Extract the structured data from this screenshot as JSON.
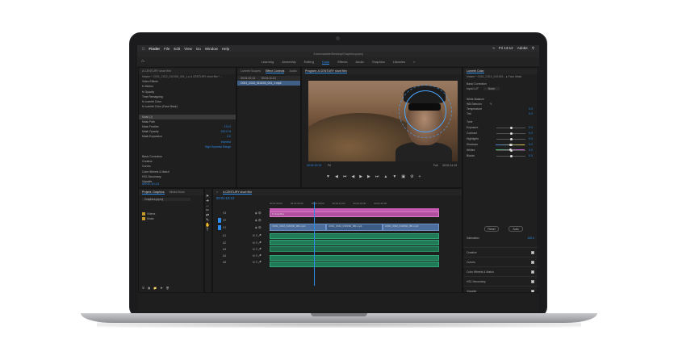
{
  "menubar": {
    "app": "Finder",
    "items": [
      "File",
      "Edit",
      "View",
      "Go",
      "Window",
      "Help"
    ],
    "clock": "Fri 13:12",
    "user": "Adobe"
  },
  "title": "/Users/adobe/Desktop/Graphics.prproj",
  "workspaces": [
    "Learning",
    "Assembly",
    "Editing",
    "Color",
    "Effects",
    "Audio",
    "Graphics",
    "Libraries"
  ],
  "active_workspace": "Color",
  "effect_controls": {
    "tabs": [
      "A CENTURY short film",
      "Lumetri Scopes",
      "Effect Controls",
      "Audio"
    ],
    "source_label": "Master * C001_C012_0101S0_001_1 ▸ A CENTURY short film * ...",
    "rows": [
      {
        "label": "Video Effects",
        "value": ""
      },
      {
        "label": "fx  Motion",
        "value": ""
      },
      {
        "label": "fx  Opacity",
        "value": ""
      },
      {
        "label": "    Time Remapping",
        "value": ""
      },
      {
        "label": "fx  Lumetri Color",
        "value": ""
      },
      {
        "label": "fx  Lumetri Color (Face Mask)",
        "value": ""
      },
      {
        "label": "",
        "value": ""
      },
      {
        "label": "Mask (1)",
        "value": ""
      },
      {
        "label": "    Mask Path",
        "value": ""
      },
      {
        "label": "    Mask Feather",
        "value": "174.0"
      },
      {
        "label": "    Mask Opacity",
        "value": "100.0 %"
      },
      {
        "label": "    Mask Expansion",
        "value": "0.0"
      },
      {
        "label": "",
        "value": "Inverted"
      },
      {
        "label": "",
        "value": "High Dynamic Range"
      },
      {
        "label": "",
        "value": ""
      },
      {
        "label": "    Basic Correction",
        "value": ""
      },
      {
        "label": "    Creative",
        "value": ""
      },
      {
        "label": "    Curves",
        "value": ""
      },
      {
        "label": "    Color Wheels & Match",
        "value": ""
      },
      {
        "label": "    HSL Secondary",
        "value": ""
      },
      {
        "label": "    Vignette",
        "value": ""
      }
    ],
    "timecode": "00:01:10:13"
  },
  "clip_list": {
    "header": [
      "00:01:10:13",
      "00:01:11:13"
    ],
    "clip": "C001_C012_0101S0_001_1.mp4"
  },
  "program": {
    "tab": "Program: A CENTURY short film",
    "timecode_left": "00:01:10:13",
    "fit": "Fit",
    "quality": "Full",
    "timecode_right": "00:01:11:13"
  },
  "project": {
    "tabs": [
      "Project: Graphics",
      "Media Brow"
    ],
    "search_placeholder": "Graphics.prproj",
    "items": [
      "Videos",
      "Music"
    ]
  },
  "timeline": {
    "tab": "A CENTURY short film",
    "timecode": "00:01:10:13",
    "ruler": [
      "00:01:00:00",
      "00:01:04:00",
      "00:01:08:00",
      "00:01:12:00",
      "00:01:16:00",
      "00:01:20:00"
    ],
    "tracks": [
      "V3",
      "V2",
      "V1",
      "A1",
      "A2",
      "A3",
      "A4",
      "A5"
    ],
    "clips": [
      "C001_C012_0101S0_001.mp4",
      "C001_C012_0101S0_001.mp4",
      "C001_C012_0101S0_001.mp4"
    ],
    "graphic": "fx  Graphics"
  },
  "lumetri": {
    "tabs": [
      "Lumetri Color",
      "A CENTURY short film"
    ],
    "source": "Master * C001_C012_0101S0... ▸ Face Mask",
    "basic_correction": "Basic Correction",
    "input_lut_label": "Input LUT",
    "input_lut_value": "None",
    "white_balance": "White Balance",
    "wb_selector": "WB Selector",
    "sliders": [
      {
        "label": "Temperature",
        "value": "0.0"
      },
      {
        "label": "Tint",
        "value": "0.0"
      }
    ],
    "tone": "Tone",
    "tone_sliders": [
      {
        "label": "Exposure",
        "value": "0.0"
      },
      {
        "label": "Contrast",
        "value": "0.0"
      },
      {
        "label": "Highlights",
        "value": "0.0"
      },
      {
        "label": "Shadows",
        "value": "0.0"
      },
      {
        "label": "Whites",
        "value": "0.0"
      },
      {
        "label": "Blacks",
        "value": "0.0"
      }
    ],
    "reset": "Reset",
    "auto": "Auto",
    "saturation_label": "Saturation",
    "saturation_value": "100.0",
    "sections": [
      "Creative",
      "Curves",
      "Color Wheels & Match",
      "HSL Secondary",
      "Vignette"
    ]
  },
  "colors": {
    "accent": "#2d8ceb",
    "video_clip": "#4b6e9c",
    "audio_clip": "#1f7a55",
    "graphic_clip": "#c35bb0"
  }
}
